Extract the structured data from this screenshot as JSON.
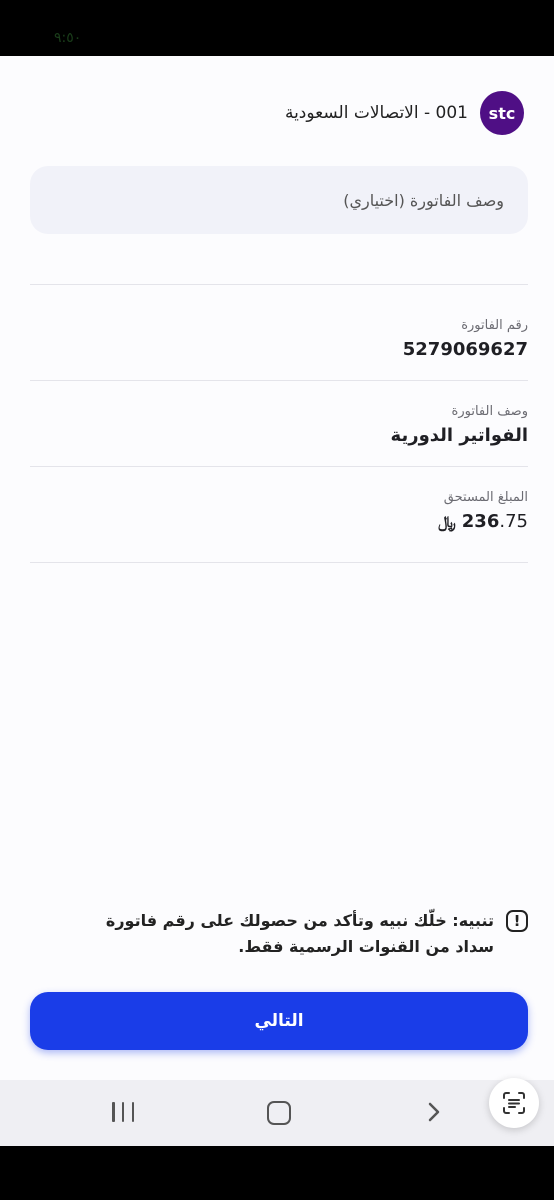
{
  "status_bar": {
    "time": "٩:٥٠"
  },
  "provider": {
    "logo_text": "stc",
    "name": "001 - الاتصالات السعودية"
  },
  "description_input": {
    "value": "",
    "placeholder": "وصف الفاتورة (اختياري)"
  },
  "details": {
    "bill_number_label": "رقم الفاتورة",
    "bill_number": "5279069627",
    "bill_description_label": "وصف الفاتورة",
    "bill_description": "الفواتير الدورية",
    "amount_label": "المبلغ المستحق",
    "amount_int": "236",
    "amount_dec": ".75",
    "currency_symbol": "﷼"
  },
  "warning": {
    "icon": "exclamation-icon",
    "text": "تنبيه: خلّك نبيه وتأكد من حصولك على رقم فاتورة سداد من القنوات الرسمية فقط."
  },
  "next_button": {
    "label": "التالي"
  },
  "colors": {
    "accent": "#1a3de8",
    "brand": "#4f0f85",
    "background": "#fcfcfe"
  }
}
